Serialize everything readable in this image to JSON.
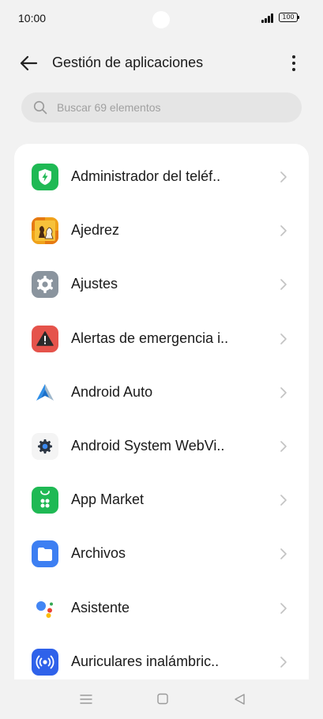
{
  "status_bar": {
    "time": "10:00",
    "battery": "100"
  },
  "header": {
    "title": "Gestión de aplicaciones"
  },
  "search": {
    "placeholder": "Buscar 69 elementos"
  },
  "apps": [
    {
      "label": "Administrador del teléf..",
      "icon": "phone-manager-icon"
    },
    {
      "label": "Ajedrez",
      "icon": "chess-icon"
    },
    {
      "label": "Ajustes",
      "icon": "settings-gear-icon"
    },
    {
      "label": "Alertas de emergencia i..",
      "icon": "emergency-alert-icon"
    },
    {
      "label": "Android Auto",
      "icon": "android-auto-icon"
    },
    {
      "label": "Android System WebVi..",
      "icon": "webview-gear-icon"
    },
    {
      "label": "App Market",
      "icon": "app-market-icon"
    },
    {
      "label": "Archivos",
      "icon": "files-folder-icon"
    },
    {
      "label": "Asistente",
      "icon": "assistant-icon"
    },
    {
      "label": "Auriculares inalámbric..",
      "icon": "wireless-earphones-icon"
    }
  ],
  "colors": {
    "background": "#f2f2f2",
    "card": "#ffffff",
    "search_bg": "#e5e5e5",
    "phone_manager": "#1fb954",
    "settings": "#8a949e",
    "emergency": "#e5534b",
    "app_market": "#1fb954",
    "files": "#3d7ff2",
    "earphones": "#2f62ea"
  }
}
